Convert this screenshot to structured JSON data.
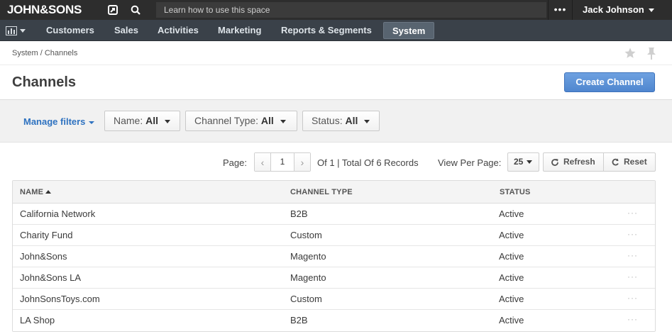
{
  "topbar": {
    "logo": "JOHN&SONS",
    "search_placeholder": "Learn how to use this space",
    "more_label": "•••",
    "user_name": "Jack Johnson"
  },
  "nav": {
    "items": [
      {
        "label": "Customers"
      },
      {
        "label": "Sales"
      },
      {
        "label": "Activities"
      },
      {
        "label": "Marketing"
      },
      {
        "label": "Reports & Segments"
      },
      {
        "label": "System"
      }
    ],
    "active": "System"
  },
  "breadcrumb": "System / Channels",
  "page": {
    "title": "Channels",
    "create_label": "Create Channel"
  },
  "filters": {
    "manage_label": "Manage filters",
    "items": [
      {
        "label": "Name:",
        "value": "All"
      },
      {
        "label": "Channel Type:",
        "value": "All"
      },
      {
        "label": "Status:",
        "value": "All"
      }
    ]
  },
  "pager": {
    "page_label": "Page:",
    "current_page": "1",
    "total_text": "Of 1 | Total Of 6 Records",
    "per_page_label": "View Per Page:",
    "per_page_value": "25",
    "refresh_label": "Refresh",
    "reset_label": "Reset"
  },
  "grid": {
    "columns": [
      "Name",
      "Channel Type",
      "Status"
    ],
    "rows": [
      {
        "name": "California Network",
        "type": "B2B",
        "status": "Active"
      },
      {
        "name": "Charity Fund",
        "type": "Custom",
        "status": "Active"
      },
      {
        "name": "John&Sons",
        "type": "Magento",
        "status": "Active"
      },
      {
        "name": "John&Sons LA",
        "type": "Magento",
        "status": "Active"
      },
      {
        "name": "JohnSonsToys.com",
        "type": "Custom",
        "status": "Active"
      },
      {
        "name": "LA Shop",
        "type": "B2B",
        "status": "Active"
      }
    ],
    "row_action_label": "···"
  },
  "colors": {
    "topbar_bg": "#2d2d2d",
    "navbar_bg": "#3a4149",
    "primary_button": "#4f86cf",
    "link": "#2e72c0"
  },
  "icons": {
    "share": "share-icon",
    "search": "search-icon",
    "dashboard": "dashboard-icon",
    "favorite": "star-icon",
    "pin": "pin-icon",
    "refresh": "refresh-icon",
    "reset": "reset-icon"
  }
}
